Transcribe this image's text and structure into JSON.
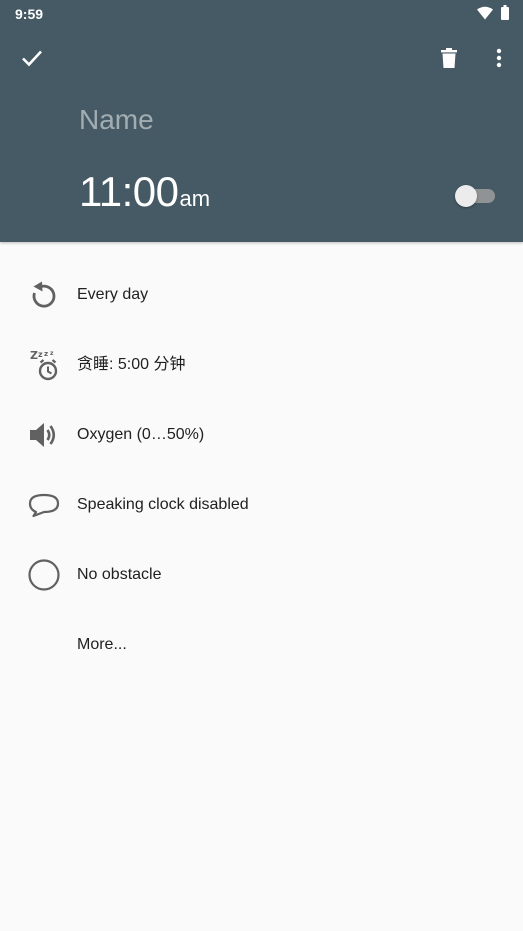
{
  "status_bar": {
    "time": "9:59",
    "icons": [
      "wifi-icon",
      "battery-icon"
    ]
  },
  "toolbar": {
    "confirm_icon": "check-icon",
    "delete_icon": "trash-icon",
    "more_icon": "more-vert-icon"
  },
  "alarm": {
    "name_placeholder": "Name",
    "name_value": "",
    "time": "11:00",
    "ampm": "am",
    "enabled": false
  },
  "settings": {
    "repeat": {
      "icon": "repeat-icon",
      "label": "Every day"
    },
    "snooze": {
      "icon": "snooze-icon",
      "label": "贪睡: 5:00 分钟"
    },
    "ringtone": {
      "icon": "volume-icon",
      "label": "Oxygen (0…50%)"
    },
    "speaking_clock": {
      "icon": "speech-bubble-icon",
      "label": "Speaking clock disabled"
    },
    "obstacle": {
      "icon": "circle-icon",
      "label": "No obstacle"
    },
    "more": {
      "label": "More..."
    }
  },
  "colors": {
    "header": "#455a64",
    "background": "#fafafa",
    "icon": "#616161",
    "text": "#212121"
  }
}
